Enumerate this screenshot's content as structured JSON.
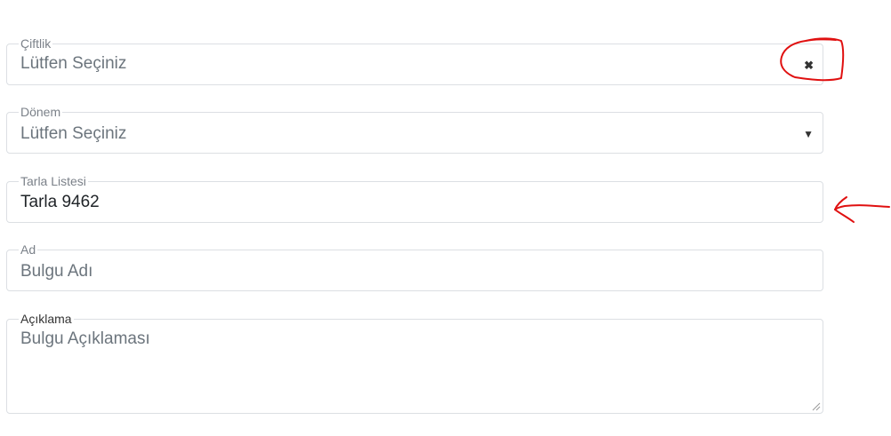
{
  "fields": {
    "ciftlik": {
      "label": "Çiftlik",
      "value": "Lütfen Seçiniz",
      "clear_glyph": "✖"
    },
    "donem": {
      "label": "Dönem",
      "value": "Lütfen Seçiniz",
      "arrow_glyph": "▼"
    },
    "tarla": {
      "label": "Tarla Listesi",
      "value": "Tarla 9462"
    },
    "ad": {
      "label": "Ad",
      "placeholder": "Bulgu Adı"
    },
    "aciklama": {
      "label": "Açıklama",
      "placeholder": "Bulgu Açıklaması"
    }
  },
  "icons": {
    "clear": "close-icon",
    "dropdown": "chevron-down-icon",
    "resize": "resize-grip-icon"
  },
  "colors": {
    "border": "#dcdfe3",
    "label": "#7b8189",
    "placeholder": "#6c757d",
    "value": "#212529",
    "annotation": "#e01010"
  }
}
